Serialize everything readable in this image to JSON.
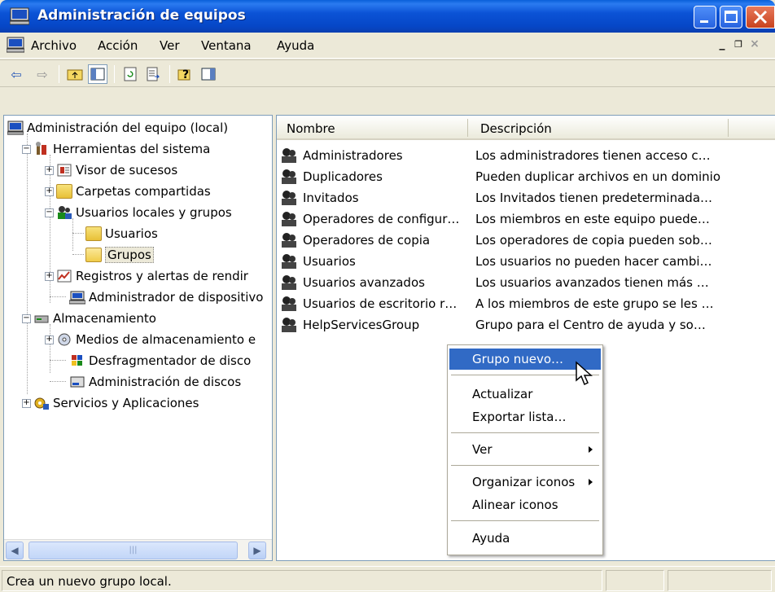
{
  "window": {
    "title": "Administración de equipos"
  },
  "menubar": {
    "items": [
      "Archivo",
      "Acción",
      "Ver",
      "Ventana",
      "Ayuda"
    ]
  },
  "tree": {
    "root": "Administración del equipo (local)",
    "herramientas": "Herramientas del sistema",
    "visor": "Visor de sucesos",
    "carpetas": "Carpetas compartidas",
    "usuarios_grupos": "Usuarios locales y grupos",
    "usuarios": "Usuarios",
    "grupos": "Grupos",
    "registros": "Registros y alertas de rendir",
    "admin_disp": "Administrador de dispositivo",
    "almacenamiento": "Almacenamiento",
    "medios": "Medios de almacenamiento e",
    "desfrag": "Desfragmentador de disco",
    "admin_discos": "Administración de discos",
    "servicios": "Servicios y Aplicaciones"
  },
  "list": {
    "col_name": "Nombre",
    "col_desc": "Descripción",
    "rows": [
      {
        "name": "Administradores",
        "desc": "Los administradores tienen acceso c…"
      },
      {
        "name": "Duplicadores",
        "desc": "Pueden duplicar archivos en un dominio"
      },
      {
        "name": "Invitados",
        "desc": "Los Invitados tienen predeterminada…"
      },
      {
        "name": "Operadores de configur…",
        "desc": "Los miembros en este equipo puede…"
      },
      {
        "name": "Operadores de copia",
        "desc": "Los operadores de copia pueden sob…"
      },
      {
        "name": "Usuarios",
        "desc": "Los usuarios no pueden hacer cambi…"
      },
      {
        "name": "Usuarios avanzados",
        "desc": "Los usuarios avanzados tienen más …"
      },
      {
        "name": "Usuarios de escritorio r…",
        "desc": "A los miembros de este grupo se les …"
      },
      {
        "name": "HelpServicesGroup",
        "desc": "Grupo para el Centro de ayuda y so…"
      }
    ]
  },
  "context_menu": {
    "nuevo": "Grupo nuevo…",
    "actualizar": "Actualizar",
    "exportar": "Exportar lista…",
    "ver": "Ver",
    "organizar": "Organizar iconos",
    "alinear": "Alinear iconos",
    "ayuda": "Ayuda"
  },
  "status": {
    "text": "Crea un nuevo grupo local."
  },
  "colors": {
    "titlebar": "#0b53d6",
    "highlight": "#316ac5",
    "chrome": "#ece9d8"
  }
}
